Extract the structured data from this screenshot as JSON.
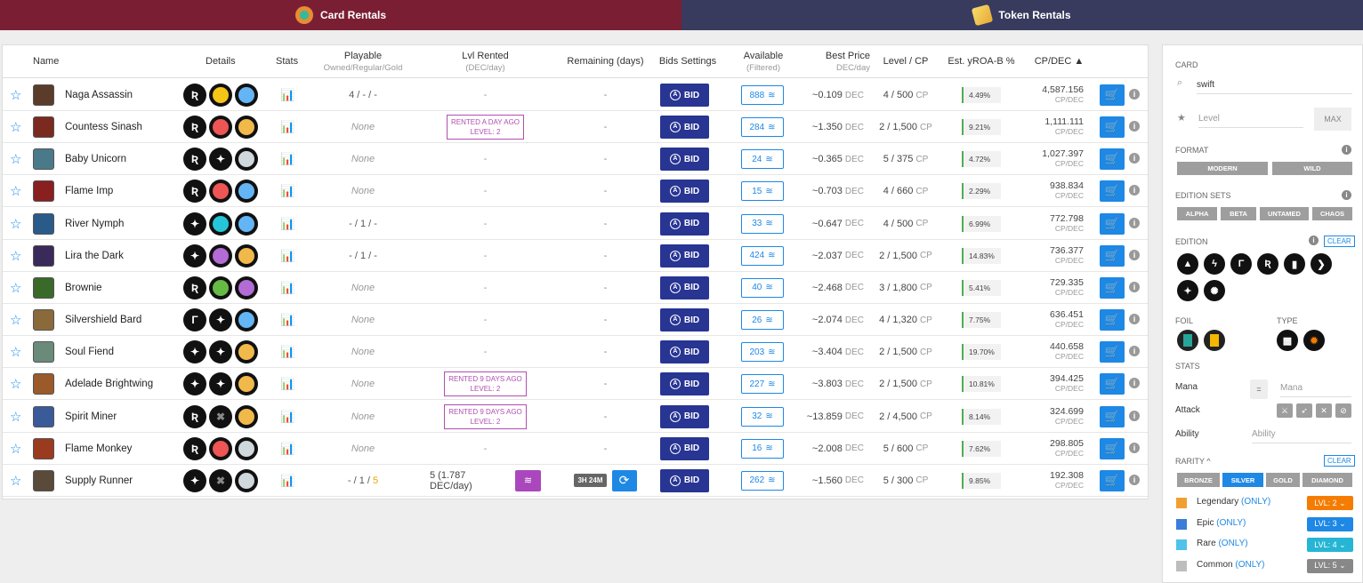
{
  "tabs": {
    "card_rentals": "Card Rentals",
    "token_rentals": "Token Rentals"
  },
  "table": {
    "headers": {
      "name": "Name",
      "details": "Details",
      "stats": "Stats",
      "playable": "Playable",
      "playable_sub": "Owned/Regular/Gold",
      "lvl_rented": "Lvl Rented",
      "lvl_rented_sub": "(DEC/day)",
      "remaining": "Remaining (days)",
      "bids": "Bids Settings",
      "available": "Available",
      "available_sub": "(Filtered)",
      "best_price": "Best Price",
      "best_price_sub": "DEC/day",
      "level_cp": "Level / CP",
      "yroa": "Est. yROA-B %",
      "cpdec": "CP/DEC ▲"
    },
    "bid_label": "BID",
    "rows": [
      {
        "name": "Naga Assassin",
        "icons": [
          "#fff",
          "#f5c518",
          "#64b5f6"
        ],
        "playable": "4 / - / -",
        "lvl": "-",
        "remain": "-",
        "avail": "888",
        "price": "~0.109",
        "unit": "DEC",
        "level": "4 / 500",
        "cp": "CP",
        "yroa": "4.49%",
        "cpdec": "4,587.156",
        "cpu": "CP/DEC",
        "thumb": "#5b3b2a"
      },
      {
        "name": "Countess Sinash",
        "icons": [
          "#fff",
          "#e55",
          "#f0b94a"
        ],
        "playable": "None",
        "lvl": "RENTED A DAY AGO|LEVEL: 2",
        "remain": "-",
        "avail": "284",
        "price": "~1.350",
        "unit": "DEC",
        "level": "2 / 1,500",
        "cp": "CP",
        "yroa": "9.21%",
        "cpdec": "1,111.111",
        "cpu": "CP/DEC",
        "thumb": "#7b2a1f"
      },
      {
        "name": "Baby Unicorn",
        "icons": [
          "#fff",
          "#fff",
          "#cfd8dc"
        ],
        "playable": "None",
        "lvl": "-",
        "remain": "-",
        "avail": "24",
        "price": "~0.365",
        "unit": "DEC",
        "level": "5 / 375",
        "cp": "CP",
        "yroa": "4.72%",
        "cpdec": "1,027.397",
        "cpu": "CP/DEC",
        "thumb": "#4a7a8a"
      },
      {
        "name": "Flame Imp",
        "icons": [
          "#fff",
          "#e55",
          "#64b5f6"
        ],
        "playable": "None",
        "lvl": "-",
        "remain": "-",
        "avail": "15",
        "price": "~0.703",
        "unit": "DEC",
        "level": "4 / 660",
        "cp": "CP",
        "yroa": "2.29%",
        "cpdec": "938.834",
        "cpu": "CP/DEC",
        "thumb": "#8a1f1f"
      },
      {
        "name": "River Nymph",
        "icons": [
          "#fff",
          "#26c6da",
          "#64b5f6"
        ],
        "playable": "- / 1 / -",
        "lvl": "-",
        "remain": "-",
        "avail": "33",
        "price": "~0.647",
        "unit": "DEC",
        "level": "4 / 500",
        "cp": "CP",
        "yroa": "6.99%",
        "cpdec": "772.798",
        "cpu": "CP/DEC",
        "thumb": "#2a5a8a"
      },
      {
        "name": "Lira the Dark",
        "icons": [
          "#fff",
          "#b36bd6",
          "#f0b94a"
        ],
        "playable": "- / 1 / -",
        "lvl": "-",
        "remain": "-",
        "avail": "424",
        "price": "~2.037",
        "unit": "DEC",
        "level": "2 / 1,500",
        "cp": "CP",
        "yroa": "14.83%",
        "cpdec": "736.377",
        "cpu": "CP/DEC",
        "thumb": "#3a2a5a"
      },
      {
        "name": "Brownie",
        "icons": [
          "#fff",
          "#66bb44",
          "#b36bd6"
        ],
        "playable": "None",
        "lvl": "-",
        "remain": "-",
        "avail": "40",
        "price": "~2.468",
        "unit": "DEC",
        "level": "3 / 1,800",
        "cp": "CP",
        "yroa": "5.41%",
        "cpdec": "729.335",
        "cpu": "CP/DEC",
        "thumb": "#3a6a2a"
      },
      {
        "name": "Silvershield Bard",
        "icons": [
          "#fff",
          "#fff",
          "#64b5f6"
        ],
        "playable": "None",
        "lvl": "-",
        "remain": "-",
        "avail": "26",
        "price": "~2.074",
        "unit": "DEC",
        "level": "4 / 1,320",
        "cp": "CP",
        "yroa": "7.75%",
        "cpdec": "636.451",
        "cpu": "CP/DEC",
        "thumb": "#8a6a3a"
      },
      {
        "name": "Soul Fiend",
        "icons": [
          "#fff",
          "#fff",
          "#f0b94a"
        ],
        "playable": "None",
        "lvl": "-",
        "remain": "-",
        "avail": "203",
        "price": "~3.404",
        "unit": "DEC",
        "level": "2 / 1,500",
        "cp": "CP",
        "yroa": "19.70%",
        "cpdec": "440.658",
        "cpu": "CP/DEC",
        "thumb": "#6a8a7a"
      },
      {
        "name": "Adelade Brightwing",
        "icons": [
          "#fff",
          "#fff",
          "#f0b94a"
        ],
        "playable": "None",
        "lvl": "RENTED 9 DAYS AGO|LEVEL: 2",
        "remain": "-",
        "avail": "227",
        "price": "~3.803",
        "unit": "DEC",
        "level": "2 / 1,500",
        "cp": "CP",
        "yroa": "10.81%",
        "cpdec": "394.425",
        "cpu": "CP/DEC",
        "thumb": "#9a5a2a"
      },
      {
        "name": "Spirit Miner",
        "icons": [
          "#fff",
          "#888",
          "#f0b94a"
        ],
        "playable": "None",
        "lvl": "RENTED 9 DAYS AGO|LEVEL: 2",
        "remain": "-",
        "avail": "32",
        "price": "~13.859",
        "unit": "DEC",
        "level": "2 / 4,500",
        "cp": "CP",
        "yroa": "8.14%",
        "cpdec": "324.699",
        "cpu": "CP/DEC",
        "thumb": "#3a5a9a"
      },
      {
        "name": "Flame Monkey",
        "icons": [
          "#fff",
          "#e55",
          "#cfd8dc"
        ],
        "playable": "None",
        "lvl": "-",
        "remain": "-",
        "avail": "16",
        "price": "~2.008",
        "unit": "DEC",
        "level": "5 / 600",
        "cp": "CP",
        "yroa": "7.62%",
        "cpdec": "298.805",
        "cpu": "CP/DEC",
        "thumb": "#9a3a1f"
      },
      {
        "name": "Supply Runner",
        "icons": [
          "#fff",
          "#888",
          "#cfd8dc"
        ],
        "playable": "- / 1 / 5",
        "lvl": "5 (1.787 DEC/day)",
        "remain": "3H 24M",
        "avail": "262",
        "price": "~1.560",
        "unit": "DEC",
        "level": "5 / 300",
        "cp": "CP",
        "yroa": "9.85%",
        "cpdec": "192.308",
        "cpu": "CP/DEC",
        "thumb": "#5a4a3a"
      }
    ]
  },
  "sidebar": {
    "card_label": "CARD",
    "search_value": "swift",
    "level_placeholder": "Level",
    "max": "MAX",
    "format_label": "FORMAT",
    "formats": [
      "MODERN",
      "WILD"
    ],
    "edition_sets_label": "EDITION SETS",
    "edition_sets": [
      "ALPHA",
      "BETA",
      "UNTAMED",
      "CHAOS"
    ],
    "edition_label": "EDITION",
    "clear": "CLEAR",
    "foil_label": "FOIL",
    "type_label": "TYPE",
    "stats_label": "STATS",
    "mana": "Mana",
    "mana_placeholder": "Mana",
    "eq": "=",
    "attack": "Attack",
    "ability": "Ability",
    "ability_placeholder": "Ability",
    "rarity_label": "RARITY ^",
    "rarity_buttons": [
      "BRONZE",
      "SILVER",
      "GOLD",
      "DIAMOND"
    ],
    "rarities": [
      {
        "name": "Legendary",
        "only": "(ONLY)",
        "lvl": "LVL: 2 ⌄",
        "color": "#f0a030",
        "btn": "#f57c00"
      },
      {
        "name": "Epic",
        "only": "(ONLY)",
        "lvl": "LVL: 3 ⌄",
        "color": "#3b7dd8",
        "btn": "#1e88e5"
      },
      {
        "name": "Rare",
        "only": "(ONLY)",
        "lvl": "LVL: 4 ⌄",
        "color": "#4fc3e8",
        "btn": "#26b5d4"
      },
      {
        "name": "Common",
        "only": "(ONLY)",
        "lvl": "LVL: 5 ⌄",
        "color": "#bdbdbd",
        "btn": "#888"
      }
    ]
  }
}
